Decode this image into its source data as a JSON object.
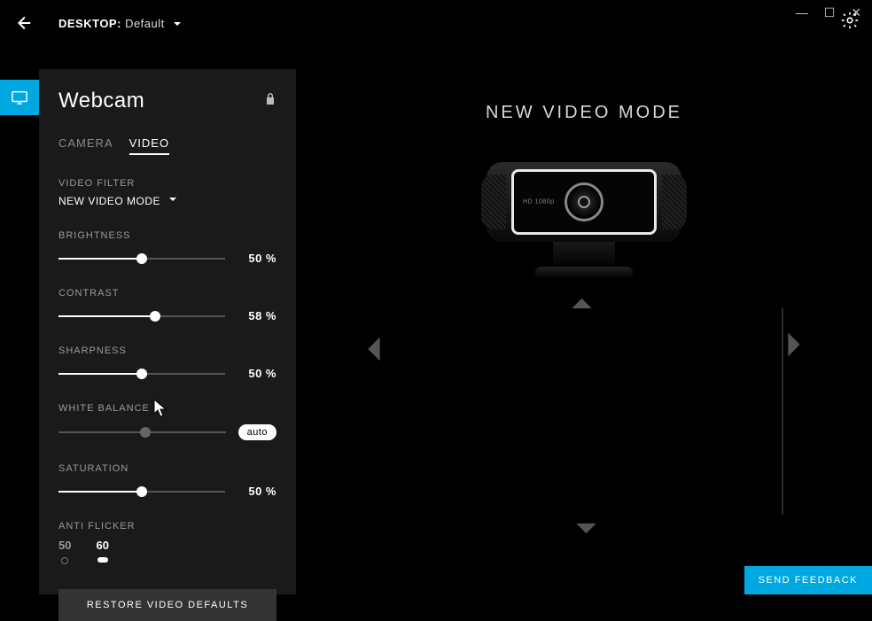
{
  "header": {
    "desktop_label": "DESKTOP:",
    "desktop_value": "Default"
  },
  "panel": {
    "title": "Webcam",
    "tabs": {
      "camera": "CAMERA",
      "video": "VIDEO"
    },
    "filter_label": "VIDEO FILTER",
    "filter_value": "NEW VIDEO MODE",
    "sliders": {
      "brightness": {
        "label": "BRIGHTNESS",
        "value": "50 %",
        "pct": 50
      },
      "contrast": {
        "label": "CONTRAST",
        "value": "58 %",
        "pct": 58
      },
      "sharpness": {
        "label": "SHARPNESS",
        "value": "50 %",
        "pct": 50
      },
      "whitebalance": {
        "label": "WHITE BALANCE",
        "auto": "auto",
        "pct": 52
      },
      "saturation": {
        "label": "SATURATION",
        "value": "50 %",
        "pct": 50
      }
    },
    "antiflicker": {
      "label": "ANTI FLICKER",
      "opt50": "50",
      "opt60": "60"
    },
    "restore": "RESTORE VIDEO DEFAULTS"
  },
  "preview": {
    "title": "NEW VIDEO MODE",
    "cam_badge": "HD 1080p"
  },
  "feedback": "SEND FEEDBACK"
}
